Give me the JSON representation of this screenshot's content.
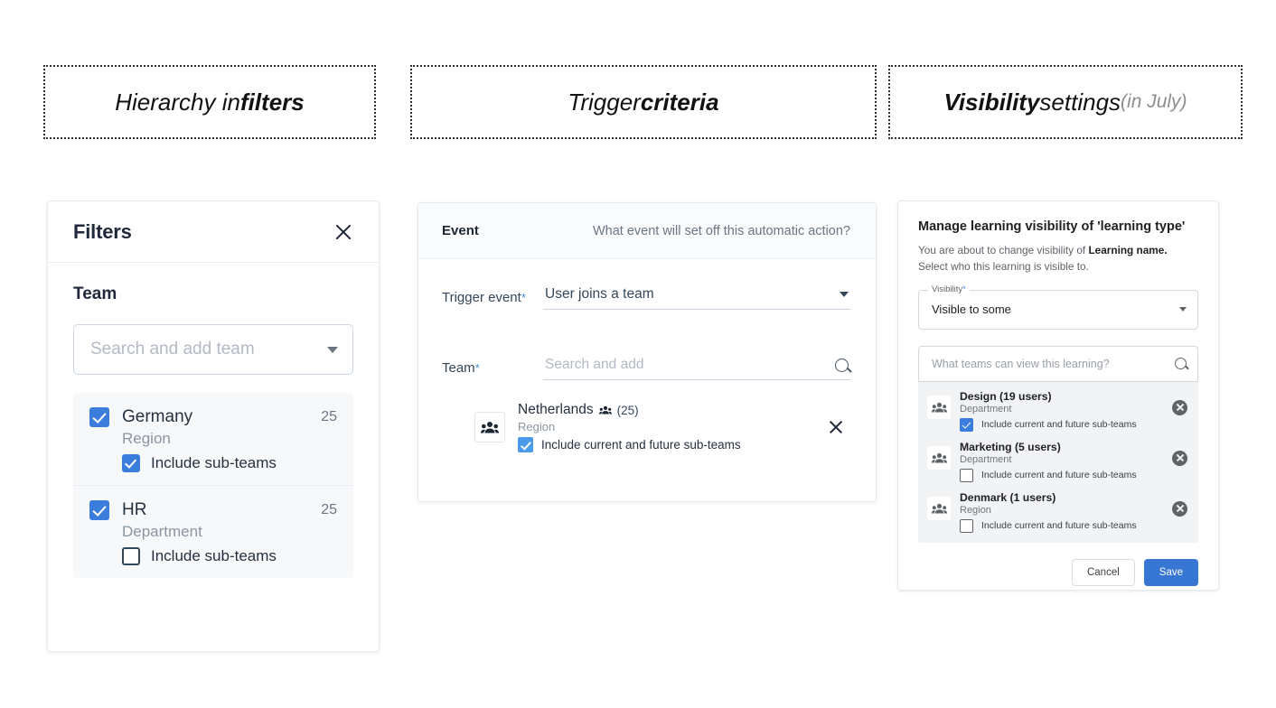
{
  "headers": {
    "filters": {
      "pre": "Hierarchy in ",
      "bold": "filters"
    },
    "trigger": {
      "pre": "Trigger ",
      "bold": "criteria"
    },
    "visibility": {
      "bold": "Visibility",
      "mid": " settings ",
      "muted": "(in July)"
    }
  },
  "filters_panel": {
    "title": "Filters",
    "close_icon": "close-icon",
    "section_label": "Team",
    "search": {
      "placeholder": "Search and add team",
      "value": ""
    },
    "teams": [
      {
        "name": "Germany",
        "count": "25",
        "type": "Region",
        "selected": true,
        "sub_label": "Include sub-teams",
        "sub_checked": true
      },
      {
        "name": "HR",
        "count": "25",
        "type": "Department",
        "selected": true,
        "sub_label": "Include sub-teams",
        "sub_checked": false
      }
    ]
  },
  "trigger_panel": {
    "header_label": "Event",
    "header_question": "What event will set off this automatic action?",
    "trigger_event": {
      "label": "Trigger event",
      "required_mark": "*",
      "value": "User joins a team"
    },
    "team": {
      "label": "Team",
      "required_mark": "*",
      "placeholder": "Search and add",
      "search_icon": "search-icon"
    },
    "selected_team": {
      "name": "Netherlands",
      "members_icon": "people-icon",
      "count": "(25)",
      "type": "Region",
      "sub_label": "Include current and future sub-teams",
      "sub_checked": true,
      "remove_icon": "close-icon"
    }
  },
  "visibility_panel": {
    "title": "Manage learning visibility of 'learning type'",
    "description_pre": "You are about to change visibility of ",
    "description_bold": "Learning name.",
    "description_post": " Select who this learning is visible to.",
    "visibility_field": {
      "legend": "Visibility",
      "required_mark": "*",
      "value": "Visible to some"
    },
    "search": {
      "placeholder": "What teams can view this learning?",
      "search_icon": "search-icon"
    },
    "teams": [
      {
        "name": "Design (19 users)",
        "type": "Department",
        "sub_label": "Include current and future sub-teams",
        "sub_checked": true,
        "remove_icon": "remove-icon"
      },
      {
        "name": "Marketing (5 users)",
        "type": "Department",
        "sub_label": "Include current and future sub-teams",
        "sub_checked": false,
        "remove_icon": "remove-icon"
      },
      {
        "name": "Denmark (1 users)",
        "type": "Region",
        "sub_label": "Include current and future sub-teams",
        "sub_checked": false,
        "remove_icon": "remove-icon"
      }
    ],
    "cancel_label": "Cancel",
    "save_label": "Save"
  },
  "colors": {
    "accent_blue": "#3b7ddd",
    "save_blue": "#3876d4",
    "required_blue": "#4a90e2",
    "panel_border": "#e6eaee",
    "list_bg": "#f6f8fa",
    "vis_list_bg": "#f1f3f4"
  }
}
